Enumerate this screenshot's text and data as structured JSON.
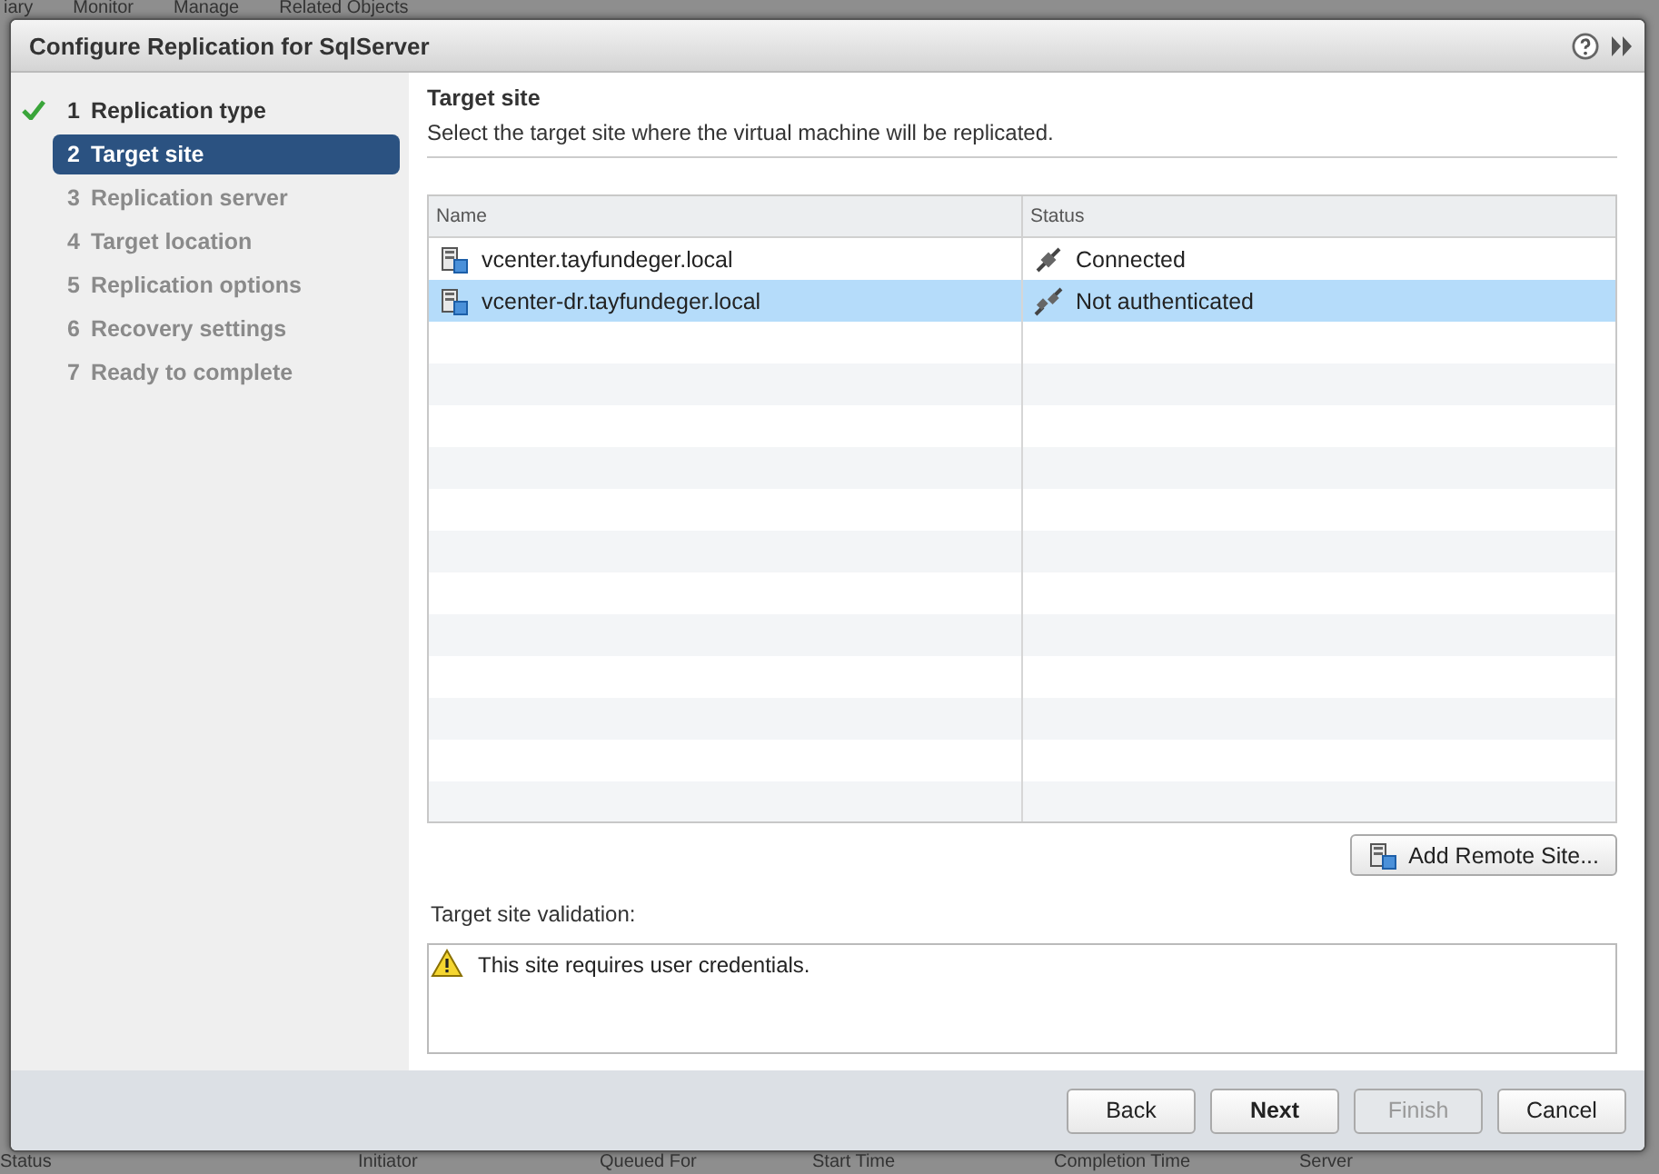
{
  "background": {
    "tabs": [
      "iary",
      "Monitor",
      "Manage",
      "Related Objects"
    ],
    "columns": [
      "Status",
      "Initiator",
      "Queued For",
      "Start Time",
      "Completion Time",
      "Server"
    ]
  },
  "dialog": {
    "title": "Configure Replication for SqlServer",
    "steps": [
      {
        "number": "1",
        "label": "Replication type",
        "completed": true,
        "selected": false
      },
      {
        "number": "2",
        "label": "Target site",
        "completed": false,
        "selected": true
      },
      {
        "number": "3",
        "label": "Replication server",
        "completed": false,
        "selected": false
      },
      {
        "number": "4",
        "label": "Target location",
        "completed": false,
        "selected": false
      },
      {
        "number": "5",
        "label": "Replication options",
        "completed": false,
        "selected": false
      },
      {
        "number": "6",
        "label": "Recovery settings",
        "completed": false,
        "selected": false
      },
      {
        "number": "7",
        "label": "Ready to complete",
        "completed": false,
        "selected": false
      }
    ],
    "heading": "Target site",
    "subtitle": "Select the target site where the virtual machine will be replicated.",
    "table": {
      "columns": [
        "Name",
        "Status"
      ],
      "rows": [
        {
          "name": "vcenter.tayfundeger.local",
          "status": "Connected",
          "kind": "connected",
          "selected": false
        },
        {
          "name": "vcenter-dr.tayfundeger.local",
          "status": "Not authenticated",
          "kind": "unplugged",
          "selected": true
        }
      ]
    },
    "add_button": "Add Remote Site...",
    "validation_label": "Target site validation:",
    "validation_message": "This site requires user credentials.",
    "buttons": [
      {
        "label": "Back",
        "primary": false,
        "disabled": false
      },
      {
        "label": "Next",
        "primary": true,
        "disabled": false
      },
      {
        "label": "Finish",
        "primary": false,
        "disabled": true
      },
      {
        "label": "Cancel",
        "primary": false,
        "disabled": false
      }
    ]
  }
}
